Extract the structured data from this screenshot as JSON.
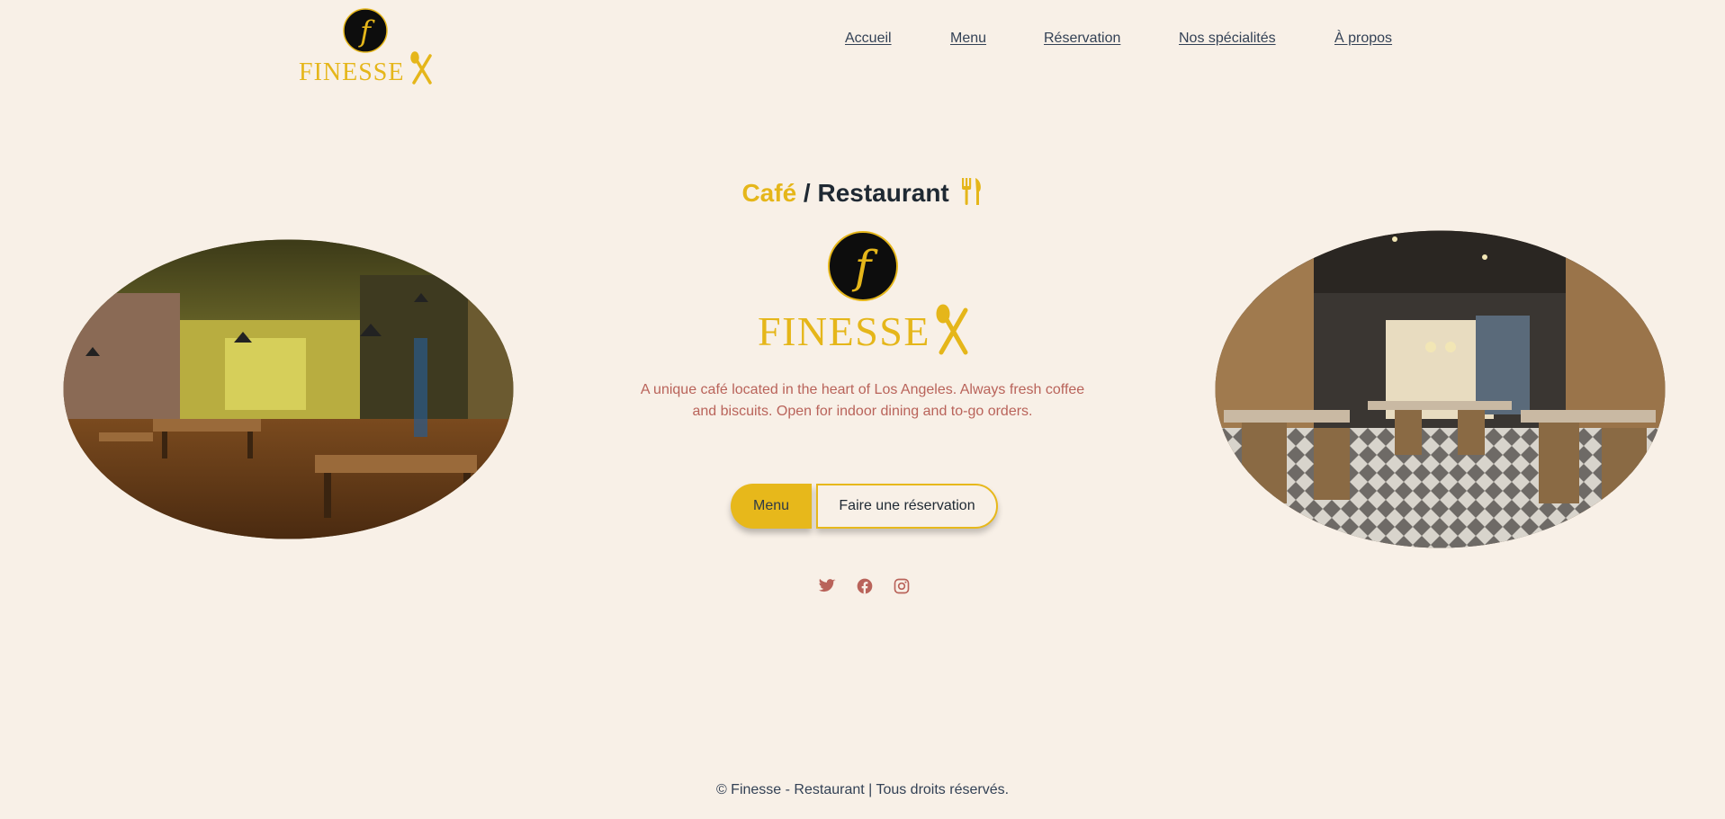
{
  "header": {
    "logo_text": "FINESSE",
    "logo_letter": "f",
    "nav": [
      {
        "label": "Accueil"
      },
      {
        "label": "Menu"
      },
      {
        "label": "Réservation"
      },
      {
        "label": "Nos spécialités"
      },
      {
        "label": "À propos"
      }
    ]
  },
  "hero": {
    "headline_accent": "Café",
    "headline_rest": " / Restaurant",
    "headline_icon": "fork-knife-icon",
    "logo_text": "FINESSE",
    "logo_letter": "f",
    "description": "A unique café located in the heart of Los Angeles. Always fresh coffee and biscuits. Open for indoor dining and to-go orders.",
    "buttons": {
      "menu_label": "Menu",
      "reservation_label": "Faire une réservation"
    },
    "social": [
      "twitter-icon",
      "facebook-icon",
      "instagram-icon"
    ],
    "images": [
      "restaurant-interior-photo-left",
      "restaurant-interior-photo-right"
    ]
  },
  "footer": {
    "text": "© Finesse - Restaurant | Tous droits réservés."
  },
  "colors": {
    "background": "#f8f0e7",
    "accent": "#e7b81b",
    "description": "#b9635a",
    "text": "#253241"
  }
}
